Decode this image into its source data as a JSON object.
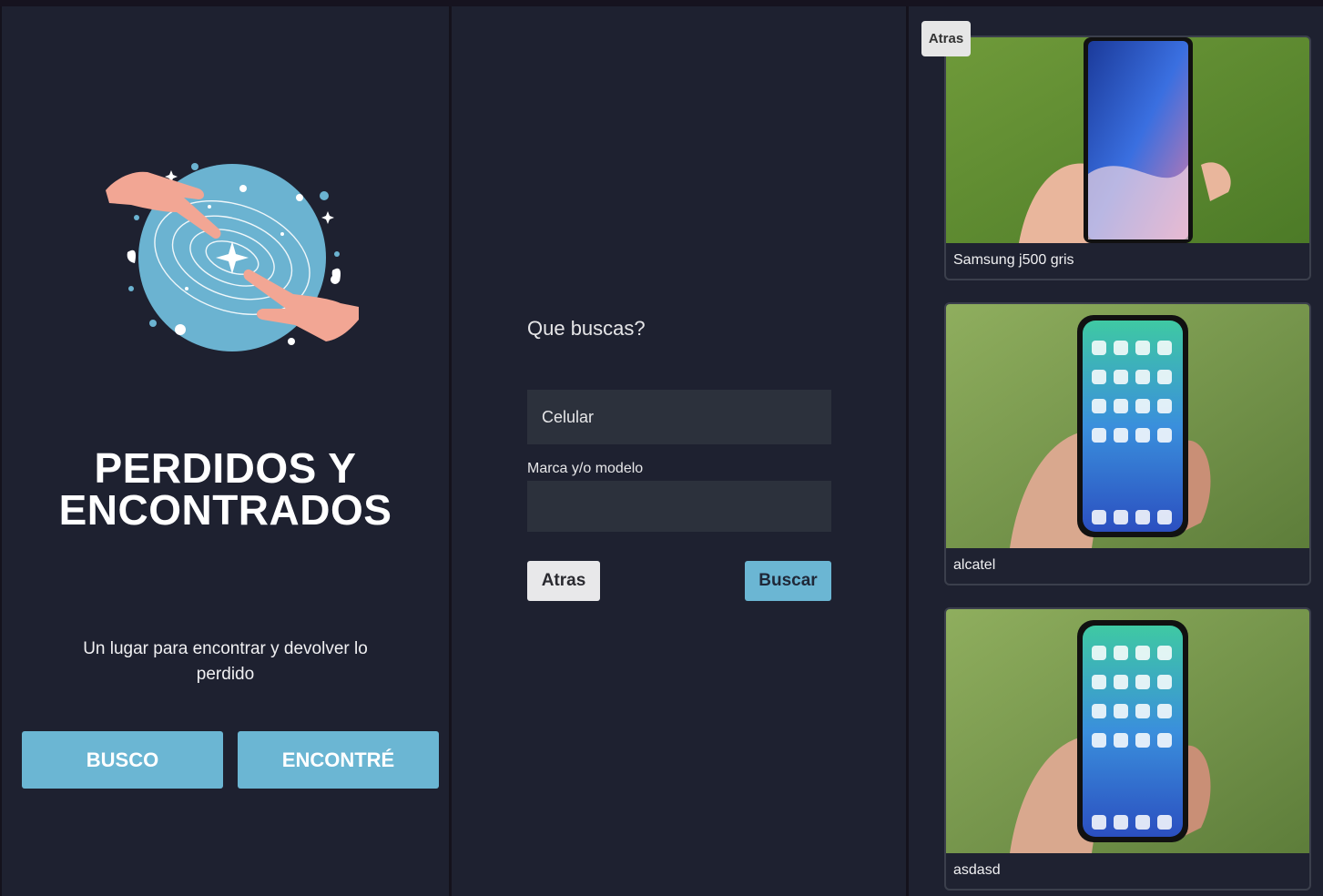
{
  "home": {
    "title": "PERDIDOS Y ENCONTRADOS",
    "tagline": "Un lugar para encontrar y devolver lo perdido",
    "busco_label": "BUSCO",
    "encontre_label": "ENCONTRÉ",
    "logo_icon": "hands-galaxy-illustration"
  },
  "search": {
    "question": "Que buscas?",
    "category_value": "Celular",
    "brand_label": "Marca y/o modelo",
    "brand_value": "",
    "back_label": "Atras",
    "search_label": "Buscar"
  },
  "results": {
    "back_label": "Atras",
    "items": [
      {
        "label": "Samsung j500 gris",
        "image": "android-phone-in-hand-photo"
      },
      {
        "label": "alcatel",
        "image": "iphone-in-hand-photo"
      },
      {
        "label": "asdasd",
        "image": "iphone-in-hand-photo"
      }
    ]
  },
  "colors": {
    "background": "#1e2130",
    "accent": "#6bb6d3",
    "field": "#2c313c",
    "light_button": "#e8e8ea"
  }
}
